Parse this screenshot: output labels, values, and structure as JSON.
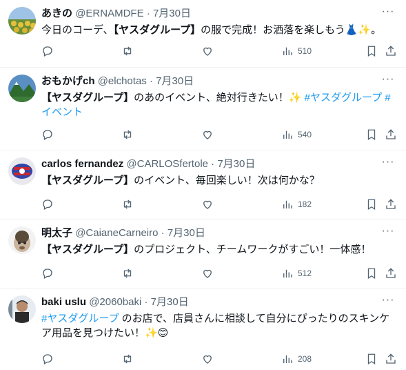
{
  "tweets": [
    {
      "name": "あきの",
      "handle": "@ERNAMDFE",
      "dot": "·",
      "date": "7月30日",
      "text_parts": [
        "今日のコーデ、",
        "【ヤスダグループ】",
        "の服で完成！お洒落を楽しもう👗✨。"
      ],
      "views": "510",
      "avatar_colors": [
        "#9fc3e6",
        "#d7c04a",
        "#6a8f3a"
      ]
    },
    {
      "name": "おもかげch",
      "handle": "@elchotas",
      "dot": "·",
      "date": "7月30日",
      "text_parts": [
        "【ヤスダグループ】",
        "のあのイベント、絶対行きたい！✨ ",
        "#ヤスダグループ #イベント"
      ],
      "views": "540",
      "avatar_colors": [
        "#5a8fc4",
        "#2f6b2f",
        "#cfd9e0"
      ]
    },
    {
      "name": "carlos fernandez",
      "handle": "@CARLOSfertole",
      "dot": "·",
      "date": "7月30日",
      "text_parts": [
        "【ヤスダグループ】",
        "のイベント、毎回楽しい！次は何かな？",
        ""
      ],
      "views": "182",
      "avatar_colors": [
        "#e8e8ee",
        "#3346a8",
        "#c8282f"
      ]
    },
    {
      "name": "明太子",
      "handle": "@CaianeCarneiro",
      "dot": "·",
      "date": "7月30日",
      "text_parts": [
        "【ヤスダグループ】",
        "のプロジェクト、チームワークがすごい！一体感！",
        ""
      ],
      "views": "512",
      "avatar_colors": [
        "#f2f2f2",
        "#5a4a3a",
        "#c9b49c"
      ]
    },
    {
      "name": "baki uslu",
      "handle": "@2060baki",
      "dot": "·",
      "date": "7月30日",
      "text_parts": [
        "#ヤスダグループ",
        " のお店で、店員さんに相談して自分にぴったりのスキンケア用品を見つけたい！✨😊",
        ""
      ],
      "views": "208",
      "avatar_colors": [
        "#e6ecf2",
        "#2b2b2b",
        "#7a8a96"
      ]
    }
  ]
}
